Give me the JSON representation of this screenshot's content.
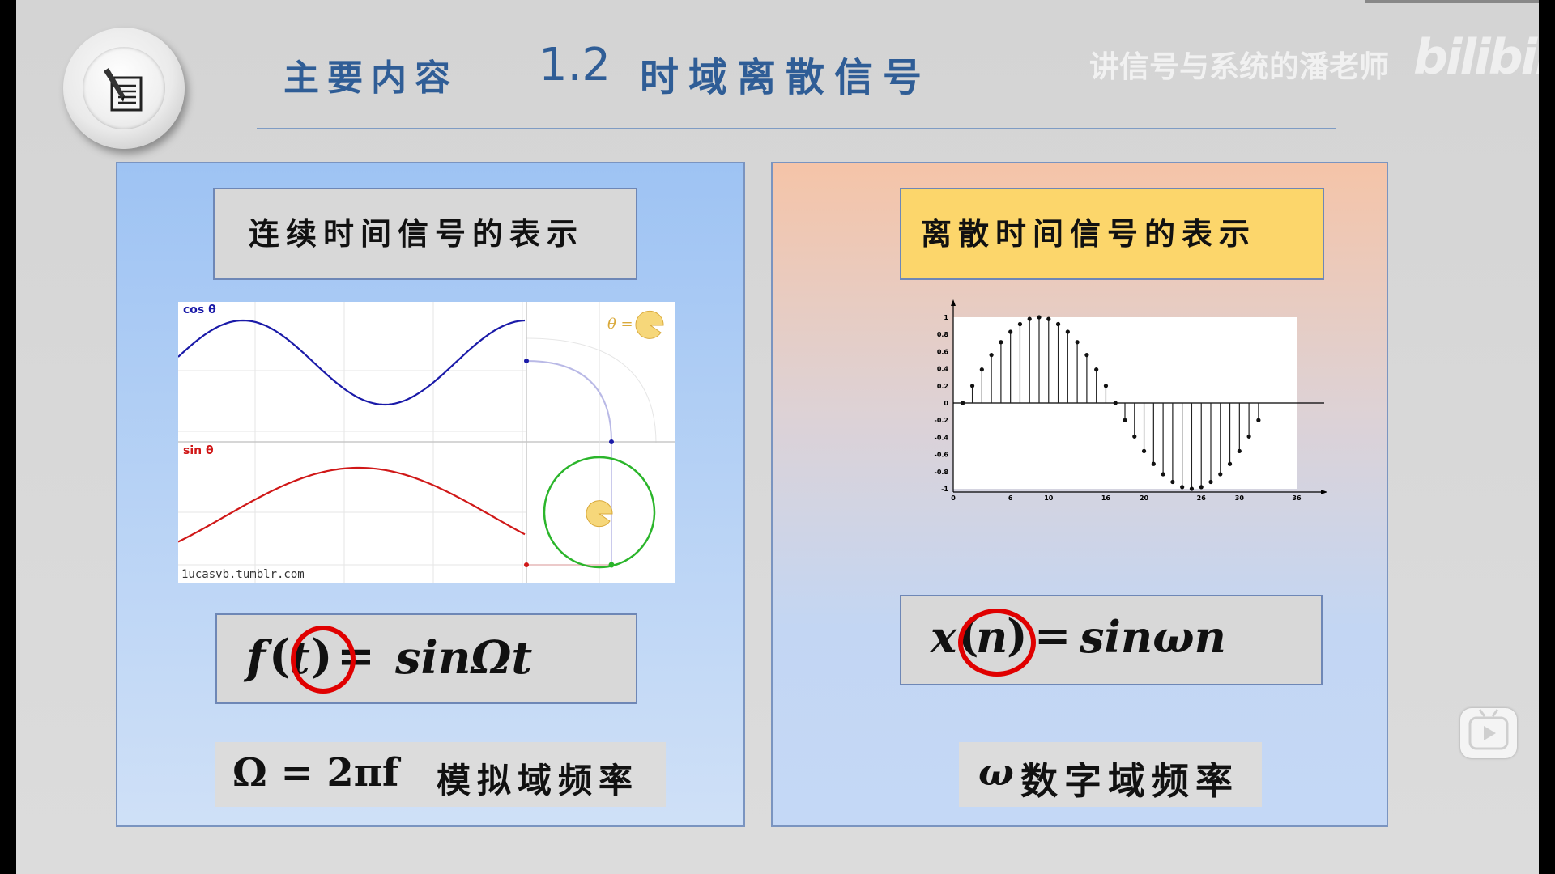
{
  "header": {
    "title_prefix": "主要内容",
    "section_number": "1.2",
    "section_title": "时域离散信号",
    "watermark": "讲信号与系统的潘老师",
    "brand": "bilibili"
  },
  "left_panel": {
    "heading": "连续时间信号的表示",
    "chart": {
      "cos_label": "cos θ",
      "sin_label": "sin θ",
      "theta_label": "θ =",
      "credit": "1ucasvb.tumblr.com",
      "cos_color": "#1a1aa8",
      "sin_color": "#d01818",
      "circle_color": "#2bb52b",
      "pie_color": "#f6d77a"
    },
    "formula": {
      "f": "f",
      "open": "(",
      "var": "t",
      "close": ")",
      "eq": "=",
      "rhs": "sinΩt"
    },
    "frequency": {
      "math": "Ω = 2πf",
      "text": "模拟域频率"
    }
  },
  "right_panel": {
    "heading": "离散时间信号的表示",
    "formula": {
      "x": "x",
      "open": "(",
      "var": "n",
      "close": ")",
      "eq": "=",
      "rhs": "sinωn"
    },
    "frequency": {
      "math": "ω",
      "text": "数字域频率"
    }
  },
  "chart_data": {
    "type": "scatter",
    "subtype": "stem",
    "x_ticks": [
      "0",
      "6",
      "10",
      "16",
      "20",
      "26",
      "30",
      "36"
    ],
    "y_ticks": [
      "1",
      "0.8",
      "0.6",
      "0.4",
      "0.2",
      "0",
      "-0.2",
      "-0.4",
      "-0.6",
      "-0.8",
      "-1"
    ],
    "xlim": [
      0,
      36
    ],
    "ylim": [
      -1,
      1
    ],
    "x": [
      1,
      2,
      3,
      4,
      5,
      6,
      7,
      8,
      9,
      10,
      11,
      12,
      13,
      14,
      15,
      16,
      17,
      18,
      19,
      20,
      21,
      22,
      23,
      24,
      25,
      26,
      27,
      28,
      29,
      30,
      31,
      32
    ],
    "y": [
      0,
      0.2,
      0.39,
      0.56,
      0.71,
      0.83,
      0.92,
      0.98,
      1.0,
      0.98,
      0.92,
      0.83,
      0.71,
      0.56,
      0.39,
      0.2,
      0,
      -0.2,
      -0.39,
      -0.56,
      -0.71,
      -0.83,
      -0.92,
      -0.98,
      -1.0,
      -0.98,
      -0.92,
      -0.83,
      -0.71,
      -0.56,
      -0.39,
      -0.2
    ]
  },
  "ui": {
    "play_icon": "play-icon"
  }
}
